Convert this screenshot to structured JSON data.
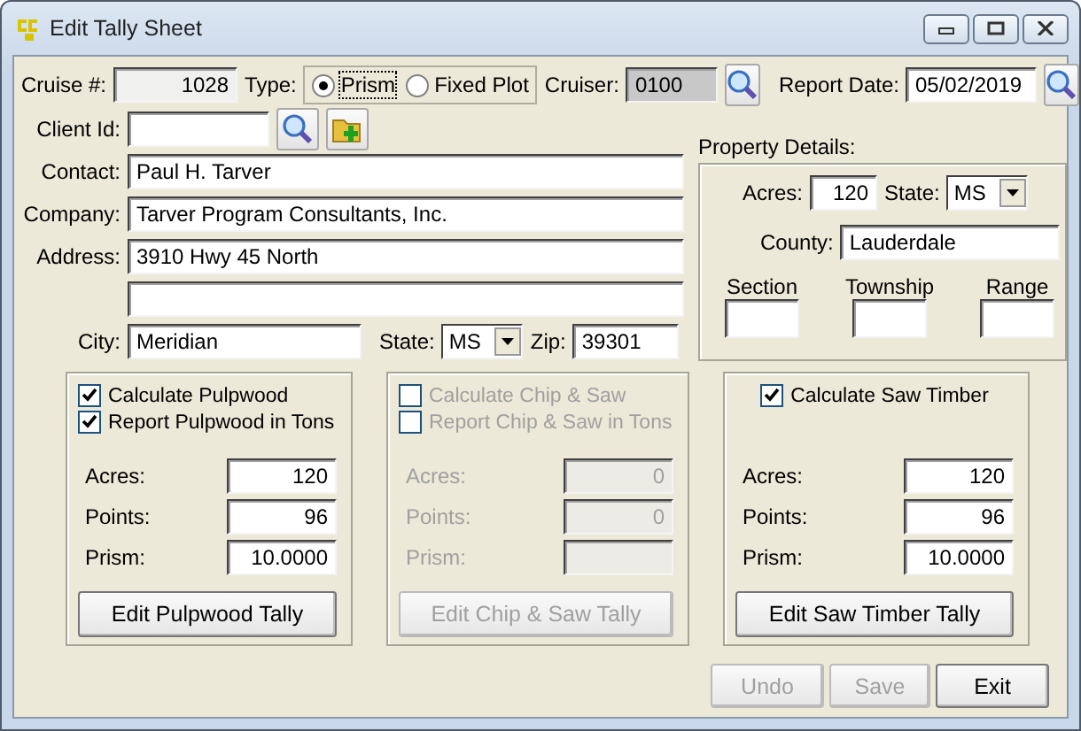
{
  "window": {
    "title": "Edit Tally Sheet"
  },
  "header": {
    "cruise_label": "Cruise #:",
    "cruise_value": "1028",
    "type_label": "Type:",
    "type_options": [
      {
        "label": "Prism",
        "selected": true
      },
      {
        "label": "Fixed Plot",
        "selected": false
      }
    ],
    "cruiser_label": "Cruiser:",
    "cruiser_value": "0100",
    "report_date_label": "Report Date:",
    "report_date_value": "05/02/2019"
  },
  "client": {
    "client_id_label": "Client Id:",
    "fields": [
      {
        "label": "Contact:",
        "value": "Paul H. Tarver"
      },
      {
        "label": "Company:",
        "value": "Tarver Program Consultants, Inc."
      },
      {
        "label": "Address:",
        "value": "3910 Hwy 45 North"
      }
    ],
    "city_label": "City:",
    "city": "Meridian",
    "state_label": "State:",
    "state": "MS",
    "zip_label": "Zip:",
    "zip": "39301"
  },
  "property": {
    "title": "Property Details:",
    "acres_label": "Acres:",
    "acres": "120",
    "state_label": "State:",
    "state": "MS",
    "county_label": "County:",
    "county": "Lauderdale",
    "section_label": "Section",
    "township_label": "Township",
    "range_label": "Range"
  },
  "groups": [
    {
      "disabled": false,
      "checkboxes": [
        {
          "label": "Calculate Pulpwood",
          "checked": true
        },
        {
          "label": "Report Pulpwood in Tons",
          "checked": true
        }
      ],
      "fields": [
        {
          "label": "Acres:",
          "value": "120"
        },
        {
          "label": "Points:",
          "value": "96"
        },
        {
          "label": "Prism:",
          "value": "10.0000"
        }
      ],
      "button": "Edit Pulpwood Tally"
    },
    {
      "disabled": true,
      "checkboxes": [
        {
          "label": "Calculate Chip & Saw",
          "checked": false
        },
        {
          "label": "Report Chip & Saw in Tons",
          "checked": false
        }
      ],
      "fields": [
        {
          "label": "Acres:",
          "value": "0"
        },
        {
          "label": "Points:",
          "value": "0"
        },
        {
          "label": "Prism:"
        }
      ],
      "button": "Edit Chip & Saw Tally"
    },
    {
      "disabled": false,
      "checkboxes": [
        {
          "label": "Calculate Saw Timber",
          "checked": true
        }
      ],
      "fields": [
        {
          "label": "Acres:",
          "value": "120"
        },
        {
          "label": "Points:",
          "value": "96"
        },
        {
          "label": "Prism:",
          "value": "10.0000"
        }
      ],
      "button": "Edit Saw Timber Tally"
    }
  ],
  "buttons": [
    {
      "label": "Undo",
      "disabled": true
    },
    {
      "label": "Save",
      "disabled": true
    },
    {
      "label": "Exit",
      "disabled": false
    }
  ]
}
